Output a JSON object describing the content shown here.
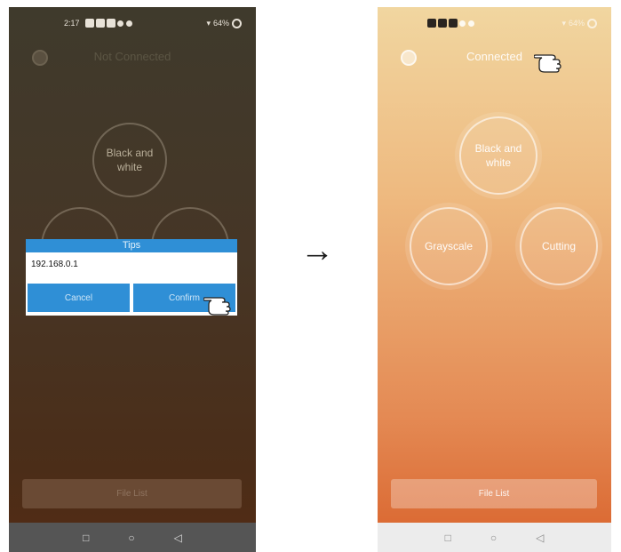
{
  "left_screen": {
    "status": {
      "time": "2:17",
      "battery": "64%"
    },
    "connection_label": "Not Connected",
    "modes": {
      "black_white": "Black and white"
    },
    "dialog": {
      "title": "Tips",
      "value": "192.168.0.1",
      "cancel_label": "Cancel",
      "confirm_label": "Confirm"
    },
    "file_list_label": "File List"
  },
  "right_screen": {
    "status": {
      "battery": "64%"
    },
    "connection_label": "Connected",
    "modes": {
      "black_white": "Black and white",
      "grayscale": "Grayscale",
      "cutting": "Cutting"
    },
    "file_list_label": "File List"
  },
  "arrow": "→",
  "nav": {
    "back": "◁",
    "home": "○",
    "recent": "□"
  },
  "colors": {
    "dialog_accent": "#2f8fd6"
  },
  "icons": [
    "gear-icon",
    "pointing-hand-icon",
    "wifi-icon",
    "battery-icon"
  ]
}
